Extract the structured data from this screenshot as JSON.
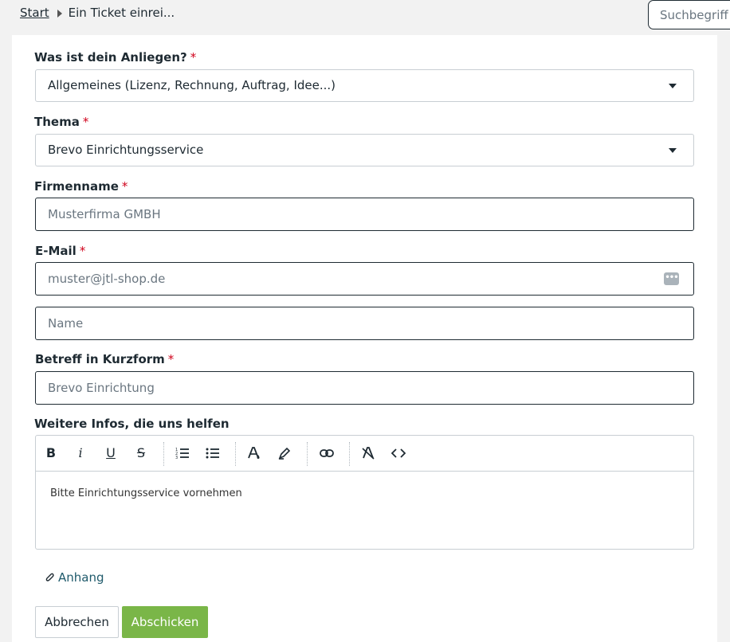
{
  "breadcrumb": {
    "home": "Start",
    "current": "Ein Ticket einrei..."
  },
  "search": {
    "placeholder": "Suchbegriff"
  },
  "form": {
    "anliegen": {
      "label": "Was ist dein Anliegen?",
      "required": "*",
      "value": "Allgemeines (Lizenz, Rechnung, Auftrag, Idee...)"
    },
    "thema": {
      "label": "Thema",
      "required": "*",
      "value": "Brevo Einrichtungsservice"
    },
    "firmenname": {
      "label": "Firmenname",
      "required": "*",
      "value": "Musterfirma GMBH"
    },
    "email": {
      "label": "E-Mail",
      "required": "*",
      "value": "muster@jtl-shop.de",
      "autofill_icon": "dots-icon"
    },
    "name": {
      "placeholder": "Name"
    },
    "betreff": {
      "label": "Betreff in Kurzform",
      "required": "*",
      "value": "Brevo Einrichtung"
    },
    "infos": {
      "label": "Weitere Infos, die uns helfen",
      "body": "Bitte Einrichtungsservice vornehmen"
    }
  },
  "toolbar": {
    "bold": "B",
    "italic": "i",
    "underline": "U",
    "strike": "S"
  },
  "attachment": {
    "label": "Anhang"
  },
  "buttons": {
    "cancel": "Abbrechen",
    "submit": "Abschicken"
  },
  "colors": {
    "submit": "#7ab648",
    "required": "#d0021b",
    "link": "#1f5a6b"
  }
}
